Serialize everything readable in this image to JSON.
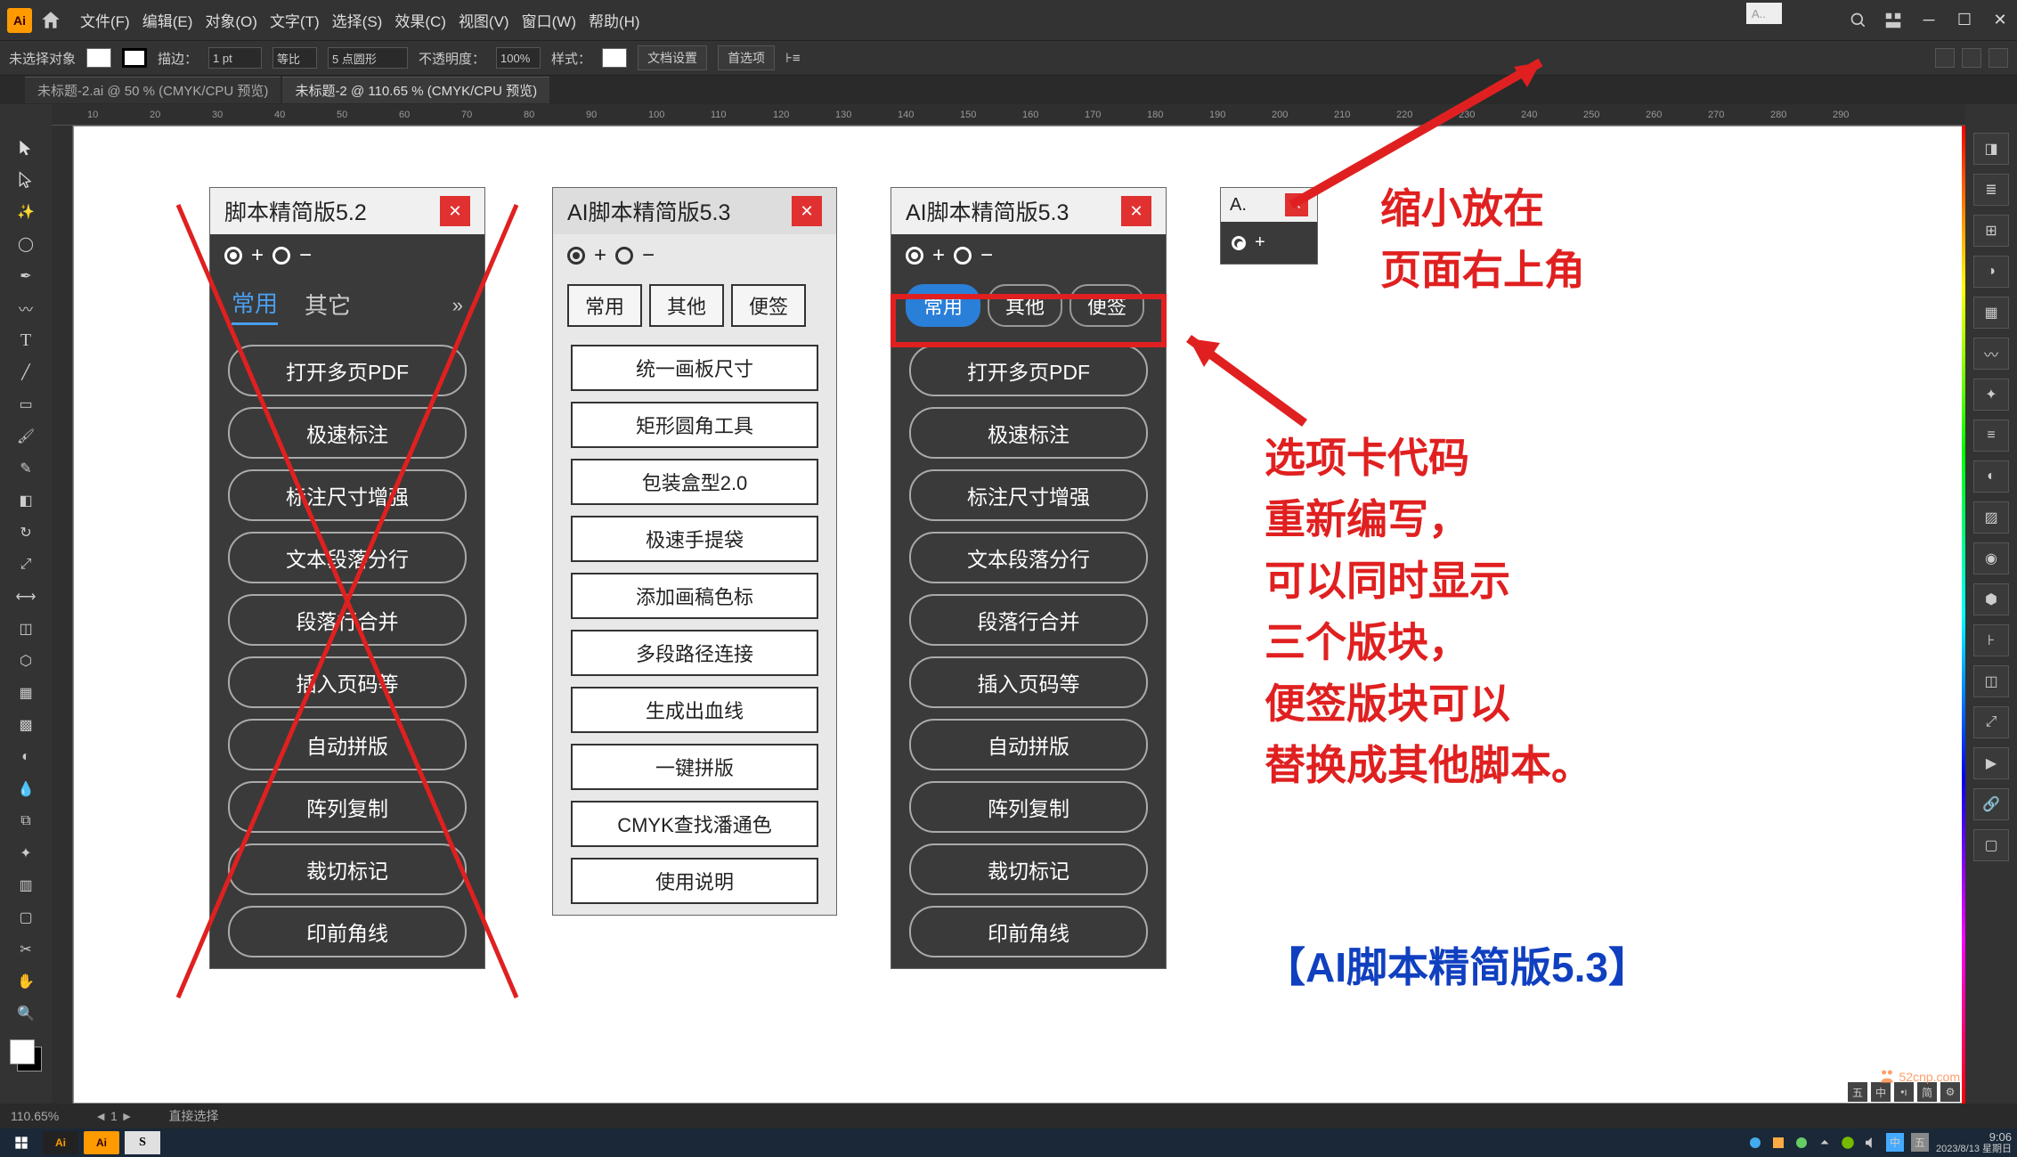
{
  "menu": {
    "file": "文件(F)",
    "edit": "编辑(E)",
    "object": "对象(O)",
    "type": "文字(T)",
    "select": "选择(S)",
    "effect": "效果(C)",
    "view": "视图(V)",
    "window": "窗口(W)",
    "help": "帮助(H)"
  },
  "options": {
    "noSel": "未选择对象",
    "stroke": "描边：",
    "strokeVal": "1 pt",
    "uniform": "等比",
    "pt5": "5 点圆形",
    "opacity": "不透明度：",
    "opacityVal": "100%",
    "style": "样式：",
    "docSetup": "文档设置",
    "prefs": "首选项"
  },
  "tabs": {
    "t1": "未标题-2.ai @ 50 % (CMYK/CPU 预览)",
    "t2": "未标题-2 @ 110.65 % (CMYK/CPU 预览)"
  },
  "dockedChip": "A..",
  "panel52": {
    "title": "脚本精简版5.2",
    "tabCommon": "常用",
    "tabOther": "其它",
    "buttons": [
      "打开多页PDF",
      "极速标注",
      "标注尺寸增强",
      "文本段落分行",
      "段落行合并",
      "插入页码等",
      "自动拼版",
      "阵列复制",
      "裁切标记",
      "印前角线"
    ]
  },
  "panel53light": {
    "title": "AI脚本精简版5.3",
    "tabCommon": "常用",
    "tabOther": "其他",
    "tabNote": "便签",
    "buttons": [
      "统一画板尺寸",
      "矩形圆角工具",
      "包装盒型2.0",
      "极速手提袋",
      "添加画稿色标",
      "多段路径连接",
      "生成出血线",
      "一键拼版",
      "CMYK查找潘通色",
      "使用说明"
    ]
  },
  "panel53dark": {
    "title": "AI脚本精简版5.3",
    "tabCommon": "常用",
    "tabOther": "其他",
    "tabNote": "便签",
    "buttons": [
      "打开多页PDF",
      "极速标注",
      "标注尺寸增强",
      "文本段落分行",
      "段落行合并",
      "插入页码等",
      "自动拼版",
      "阵列复制",
      "裁切标记",
      "印前角线"
    ]
  },
  "miniPanel": {
    "title": "A."
  },
  "annotations": {
    "a1": "缩小放在",
    "a2": "页面右上角",
    "b1": "选项卡代码",
    "b2": "重新编写，",
    "b3": "可以同时显示",
    "b4": "三个版块，",
    "b5": "便签版块可以",
    "b6": "替换成其他脚本。",
    "blue": "【AI脚本精简版5.3】"
  },
  "status": {
    "zoom": "110.65%",
    "sel": "直接选择"
  },
  "taskbar": {
    "time": "9:06",
    "date": "2023/8/13 星期日",
    "ime": "中"
  },
  "ruler": [
    "10",
    "20",
    "30",
    "40",
    "50",
    "60",
    "70",
    "80",
    "90",
    "100",
    "110",
    "120",
    "130",
    "140",
    "150",
    "160",
    "170",
    "180",
    "190",
    "200",
    "210",
    "220",
    "230",
    "240",
    "250",
    "260",
    "270",
    "280",
    "290"
  ],
  "watermark": "52cnp.com"
}
